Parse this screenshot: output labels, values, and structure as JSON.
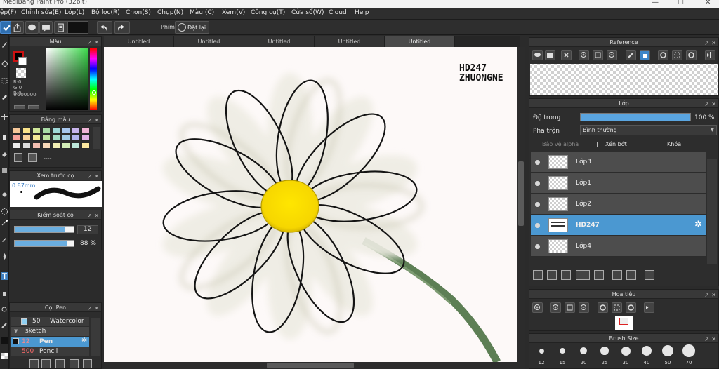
{
  "window": {
    "title": "MediBang Paint Pro (32bit)",
    "min": "—",
    "max": "☐",
    "close": "✕"
  },
  "menu": [
    "ệp(F)",
    "Chỉnh sửa(E)",
    "Lớp(L)",
    "Bộ lọc(R)",
    "Chọn(S)",
    "Chụp(N)",
    "Màu (C)",
    "Xem(V)",
    "Công cụ(T)",
    "Cửa sổ(W)",
    "Cloud",
    "Help"
  ],
  "toolbar": {
    "shortcut_label": "Phím",
    "reset_label": "Đặt lại"
  },
  "color_panel": {
    "title": "Màu",
    "r": "R:0",
    "g": "G:0",
    "b": "B:0",
    "hex": "#000000"
  },
  "palette_panel": {
    "title": "Bảng màu",
    "dash": "----",
    "swatches": [
      "#f6c89a",
      "#f9e38a",
      "#cfe79a",
      "#a9dca6",
      "#9fd8d8",
      "#a8c7ee",
      "#c8b4ec",
      "#f0b4d6",
      "#f7a39a",
      "#f7d29a",
      "#f2ea97",
      "#bfe3a0",
      "#a4dbc5",
      "#a3cbe6",
      "#b3b3ec",
      "#e3b2e6",
      "#eeeeee",
      "#dddddd",
      "#f4bfb2",
      "#f8d9b8",
      "#f3efb3",
      "#d4edb7",
      "#bde7da",
      "#fde8a0"
    ]
  },
  "brush_preview": {
    "title": "Xem trước cọ",
    "size": "0.87mm"
  },
  "brush_control": {
    "title": "Kiểm soát cọ",
    "size_value": "12",
    "opacity_value": "88 %",
    "size_frac": 0.85,
    "opacity_frac": 0.88
  },
  "brush_panel": {
    "title": "Cọ: Pen",
    "items": [
      {
        "size": "50",
        "name": "Watercolor"
      },
      {
        "size": "",
        "name": "sketch"
      },
      {
        "size": "12",
        "name": "Pen"
      },
      {
        "size": "500",
        "name": "Pencil"
      }
    ]
  },
  "tabs": [
    "Untitled",
    "Untitled",
    "Untitled",
    "Untitled",
    "Untitled"
  ],
  "canvas": {
    "watermark_line1": "HD247",
    "watermark_line2": "ZHUONGNE"
  },
  "reference_panel": {
    "title": "Reference"
  },
  "layer_panel": {
    "title": "Lớp",
    "opacity_label": "Độ trong",
    "opacity_value": "100 %",
    "opacity_frac": 1.0,
    "blend_label": "Pha trộn",
    "blend_value": "Bình thường",
    "protect_alpha": "Bảo vệ alpha",
    "clipping": "Xén bớt",
    "lock": "Khóa",
    "layers": [
      {
        "name": "Lớp3",
        "selected": false
      },
      {
        "name": "Lớp1",
        "selected": false
      },
      {
        "name": "Lớp2",
        "selected": false
      },
      {
        "name": "HD247",
        "selected": true
      },
      {
        "name": "Lớp4",
        "selected": false
      }
    ]
  },
  "navigator_panel": {
    "title": "Hoa tiêu"
  },
  "brush_size_panel": {
    "title": "Brush Size",
    "sizes": [
      "12",
      "15",
      "20",
      "25",
      "30",
      "40",
      "50",
      "70"
    ]
  }
}
